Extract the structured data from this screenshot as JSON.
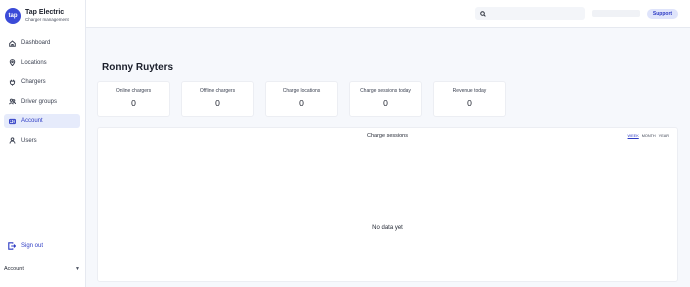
{
  "brand": {
    "logo_text": "tap",
    "title": "Tap Electric",
    "subtitle": "Charger management",
    "accent": "#3b4bd8"
  },
  "nav": {
    "items": [
      {
        "label": "Dashboard",
        "icon": "home-icon",
        "active": false
      },
      {
        "label": "Locations",
        "icon": "map-pin-icon",
        "active": false
      },
      {
        "label": "Chargers",
        "icon": "plug-icon",
        "active": false
      },
      {
        "label": "Driver groups",
        "icon": "users-icon",
        "active": false
      },
      {
        "label": "Account",
        "icon": "id-card-icon",
        "active": true
      },
      {
        "label": "Users",
        "icon": "user-icon",
        "active": false
      }
    ],
    "signout_label": "Sign out",
    "account_label": "Account"
  },
  "topbar": {
    "search_placeholder": "",
    "support_label": "Support"
  },
  "page": {
    "title": "Ronny Ruyters"
  },
  "stats": [
    {
      "label": "Online chargers",
      "value": "0"
    },
    {
      "label": "Offline chargers",
      "value": "0"
    },
    {
      "label": "Charge locations",
      "value": "0"
    },
    {
      "label": "Charge sessions today",
      "value": "0"
    },
    {
      "label": "Revenue today",
      "value": "0"
    }
  ],
  "sessions": {
    "title": "Charge sessions",
    "periods": [
      {
        "label": "WEEK",
        "active": true
      },
      {
        "label": "MONTH",
        "active": false
      },
      {
        "label": "YEAR",
        "active": false
      }
    ],
    "empty_text": "No data yet"
  }
}
